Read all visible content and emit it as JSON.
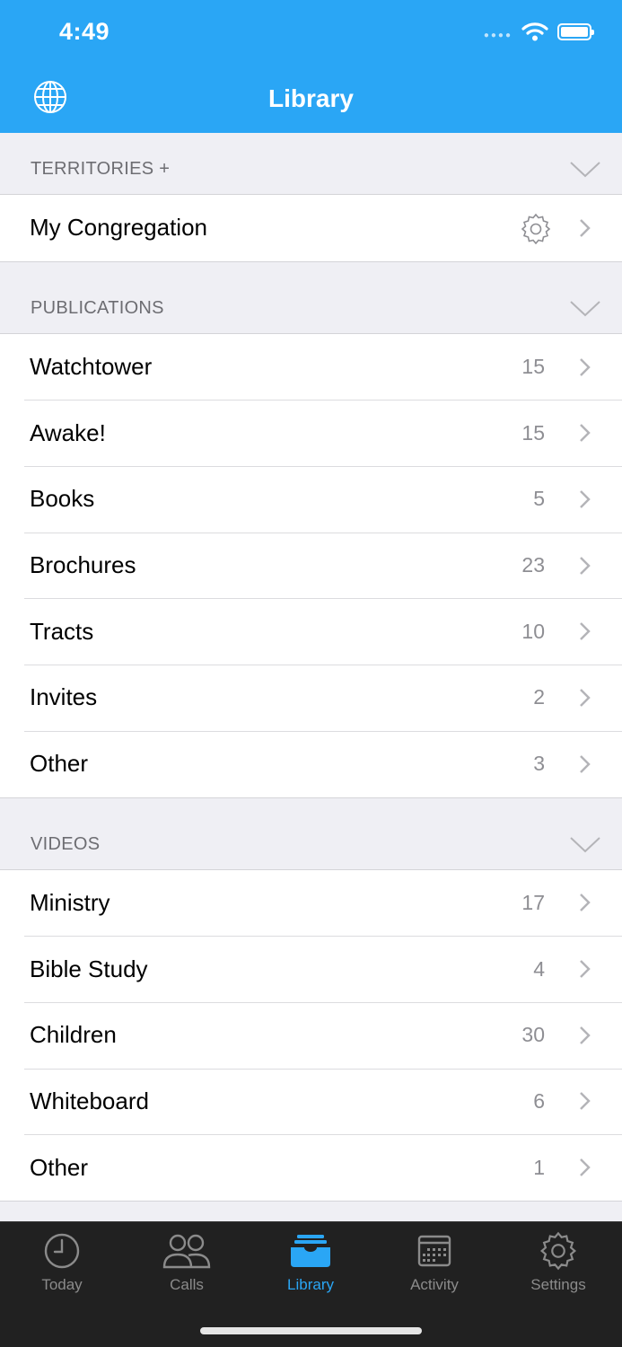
{
  "status": {
    "time": "4:49"
  },
  "nav": {
    "title": "Library"
  },
  "territories": {
    "header": "TERRITORIES +",
    "items": [
      {
        "label": "My Congregation"
      }
    ]
  },
  "publications": {
    "header": "PUBLICATIONS",
    "items": [
      {
        "label": "Watchtower",
        "count": "15"
      },
      {
        "label": "Awake!",
        "count": "15"
      },
      {
        "label": "Books",
        "count": "5"
      },
      {
        "label": "Brochures",
        "count": "23"
      },
      {
        "label": "Tracts",
        "count": "10"
      },
      {
        "label": "Invites",
        "count": "2"
      },
      {
        "label": "Other",
        "count": "3"
      }
    ]
  },
  "videos": {
    "header": "VIDEOS",
    "items": [
      {
        "label": "Ministry",
        "count": "17"
      },
      {
        "label": "Bible Study",
        "count": "4"
      },
      {
        "label": "Children",
        "count": "30"
      },
      {
        "label": "Whiteboard",
        "count": "6"
      },
      {
        "label": "Other",
        "count": "1"
      }
    ]
  },
  "tabs": [
    {
      "label": "Today",
      "icon": "clock-icon"
    },
    {
      "label": "Calls",
      "icon": "people-icon"
    },
    {
      "label": "Library",
      "icon": "tray-icon",
      "active": true
    },
    {
      "label": "Activity",
      "icon": "calendar-icon"
    },
    {
      "label": "Settings",
      "icon": "gear-icon"
    }
  ],
  "colors": {
    "accent": "#2aa6f5",
    "tabbar": "#212121",
    "background": "#efeff4"
  }
}
